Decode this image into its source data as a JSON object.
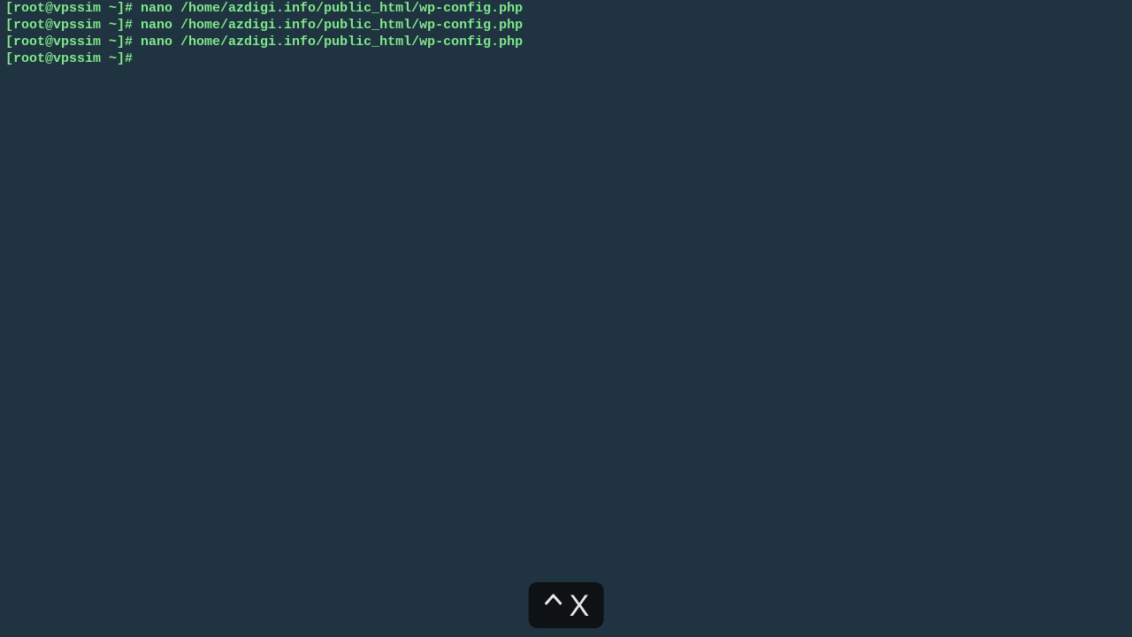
{
  "terminal": {
    "lines": [
      {
        "prompt": "[root@vpssim ~]# ",
        "command": "nano /home/azdigi.info/public_html/wp-config.php"
      },
      {
        "prompt": "[root@vpssim ~]# ",
        "command": "nano /home/azdigi.info/public_html/wp-config.php"
      },
      {
        "prompt": "[root@vpssim ~]# ",
        "command": "nano /home/azdigi.info/public_html/wp-config.php"
      },
      {
        "prompt": "[root@vpssim ~]# ",
        "command": ""
      }
    ]
  },
  "overlay": {
    "key_label": "X"
  }
}
